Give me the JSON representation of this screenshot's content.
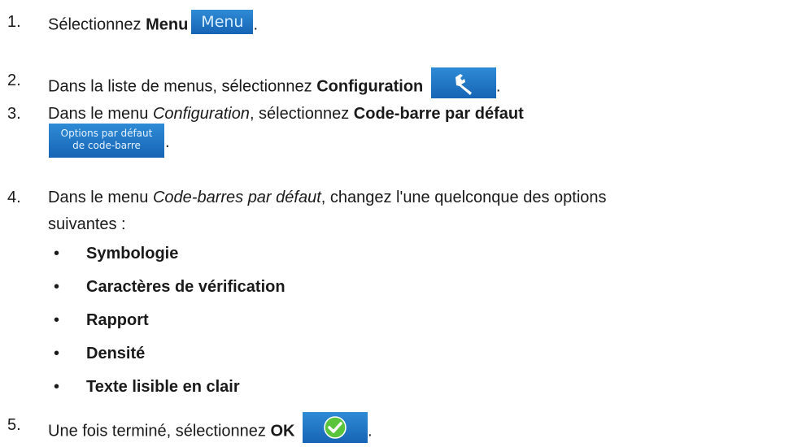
{
  "steps": [
    {
      "num": "1.",
      "pre": "Sélectionnez ",
      "bold": "Menu",
      "button": "Menu",
      "post": "."
    },
    {
      "num": "2.",
      "pre": "Dans la liste de menus, sélectionnez ",
      "bold": "Configuration",
      "button_icon": "wrench-icon",
      "post": "."
    },
    {
      "num": "3.",
      "pre": "Dans le menu ",
      "italic": "Configuration",
      "mid": ", sélectionnez ",
      "bold": "Code-barre par défaut",
      "button_line1": "Options par défaut",
      "button_line2": "de code-barre",
      "post": "."
    },
    {
      "num": "4.",
      "pre": "Dans le menu ",
      "italic": "Code-barres par défaut",
      "mid": ", changez l'une quelconque des options",
      "line2": "suivantes :"
    },
    {
      "num": "5.",
      "pre": "Une fois terminé, sélectionnez ",
      "bold": "OK",
      "button_icon": "checkmark-icon",
      "post": "."
    }
  ],
  "bullet_char": "•",
  "options": [
    "Symbologie",
    "Caractères de vérification",
    "Rapport",
    "Densité",
    "Texte lisible en clair"
  ],
  "colors": {
    "button": "#1f74c6",
    "check": "#5bc43d"
  }
}
